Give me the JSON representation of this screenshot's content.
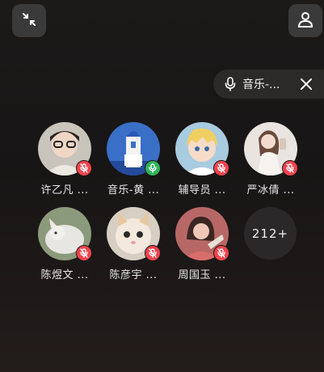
{
  "topbar": {
    "minimize_icon": "collapse-arrows-icon",
    "profile_icon": "person-icon"
  },
  "speaker": {
    "label": "音乐-...",
    "mic_icon": "microphone-icon",
    "close_icon": "close-icon"
  },
  "members": [
    {
      "name": "许乙凡 ...",
      "muted": true
    },
    {
      "name": "音乐-黄 ...",
      "muted": false
    },
    {
      "name": "辅导员 ...",
      "muted": true
    },
    {
      "name": "严冰倩 ...",
      "muted": true
    },
    {
      "name": "陈煜文 ...",
      "muted": true
    },
    {
      "name": "陈彦宇 ...",
      "muted": true
    },
    {
      "name": "周国玉 ...",
      "muted": true
    }
  ],
  "more_count": "212+",
  "colors": {
    "muted": "#f2434d",
    "active": "#2fb45a",
    "button_bg": "#3a3a3a"
  }
}
